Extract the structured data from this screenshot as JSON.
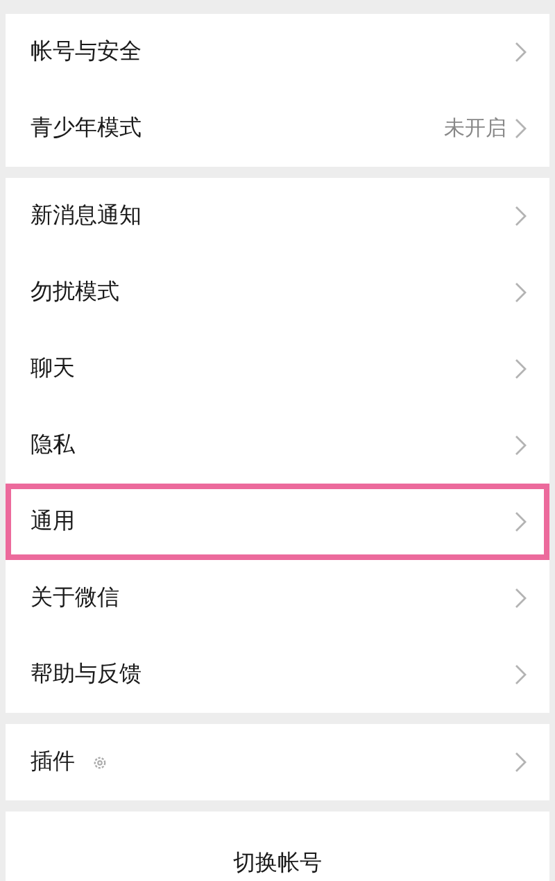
{
  "sections": [
    {
      "items": [
        {
          "kind": "plain",
          "label": "帐号与安全",
          "highlighted": false
        },
        {
          "kind": "plain",
          "label": "青少年模式",
          "value": "未开启",
          "highlighted": false
        }
      ]
    },
    {
      "items": [
        {
          "kind": "plain",
          "label": "新消息通知",
          "highlighted": false
        },
        {
          "kind": "plain",
          "label": "勿扰模式",
          "highlighted": false
        },
        {
          "kind": "plain",
          "label": "聊天",
          "highlighted": false
        },
        {
          "kind": "plain",
          "label": "隐私",
          "highlighted": false
        },
        {
          "kind": "plain",
          "label": "通用",
          "highlighted": true
        },
        {
          "kind": "plain",
          "label": "关于微信",
          "highlighted": false
        },
        {
          "kind": "plain",
          "label": "帮助与反馈",
          "highlighted": false
        }
      ]
    },
    {
      "items": [
        {
          "kind": "gear",
          "label": "插件",
          "highlighted": false
        }
      ]
    }
  ],
  "footer_button": "切换帐号"
}
